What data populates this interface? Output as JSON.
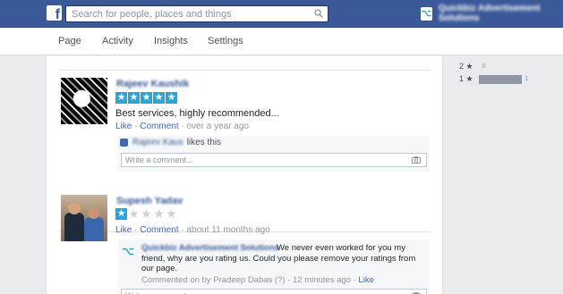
{
  "topbar": {
    "logo_glyph": "f",
    "search_placeholder": "Search for people, places and things",
    "search_icon": "magnifier-icon",
    "page_logo_glyph": "⌥",
    "page_name": "Quickbiz Advertisement Solutions"
  },
  "tabs": [
    {
      "label": "Page"
    },
    {
      "label": "Activity"
    },
    {
      "label": "Insights"
    },
    {
      "label": "Settings"
    }
  ],
  "reviews": [
    {
      "reviewer_name": "Rajeev Kaushik",
      "rating": 5,
      "max_rating": 5,
      "text": "Best services, highly recommended...",
      "like_label": "Like",
      "comment_label": "Comment",
      "separator": " · ",
      "time": "over a year ago",
      "liked_by": "Rajeev Kaus",
      "likes_text": "likes this",
      "comment_placeholder": "Write a comment..."
    },
    {
      "reviewer_name": "Supesh Yadav",
      "rating": 1,
      "max_rating": 5,
      "like_label": "Like",
      "comment_label": "Comment",
      "separator": " · ",
      "time": "about 11 months ago",
      "reply": {
        "author": "Quickbiz Advertisement Solutions",
        "text": "We never even worked for you my friend, why are you rating us. Could you please remove your ratings from our page.",
        "meta_prefix": "Commented on by Pradeep Dabas",
        "meta_badge": "(?)",
        "time": "12 minutes ago",
        "like_label": "Like"
      },
      "comment_placeholder": "Write a comment..."
    }
  ],
  "rating_breakdown": [
    {
      "stars_label": "2 ★",
      "count": "0",
      "fraction": 0.0
    },
    {
      "stars_label": "1 ★",
      "count": "1",
      "fraction": 1.0
    }
  ],
  "colors": {
    "topbar": "#3b5998",
    "star_full": "#2aa5d6",
    "link": "#4267b2"
  }
}
